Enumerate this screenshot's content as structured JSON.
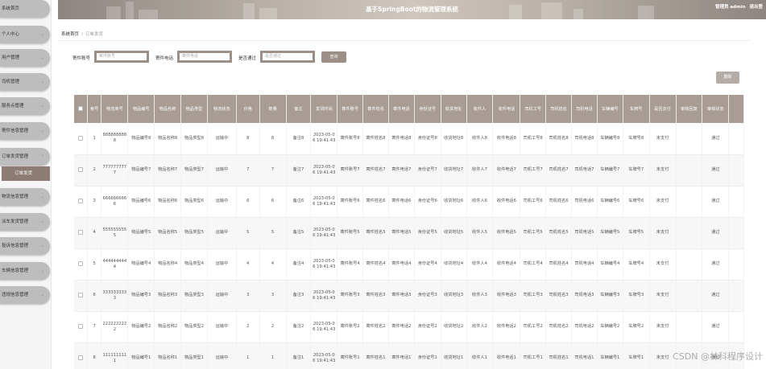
{
  "sidebar": {
    "items": [
      {
        "label": "系统首页",
        "arrow": ""
      },
      {
        "label": "个人中心",
        "arrow": "⌄"
      },
      {
        "label": "用户管理",
        "arrow": "⌄"
      },
      {
        "label": "司机管理",
        "arrow": "⌄"
      },
      {
        "label": "服务点管理",
        "arrow": "⌄"
      },
      {
        "label": "寄件信息管理",
        "arrow": "⌄"
      },
      {
        "label": "订单发货管理",
        "arrow": "⌃"
      },
      {
        "label": "物流信息管理",
        "arrow": "⌄"
      },
      {
        "label": "派车发货管理",
        "arrow": "⌄"
      },
      {
        "label": "投诉信息管理",
        "arrow": "⌄"
      },
      {
        "label": "车辆信息管理",
        "arrow": "⌄"
      },
      {
        "label": "违规信息管理",
        "arrow": "⌄"
      }
    ],
    "submenu": {
      "label": "订单发货"
    }
  },
  "header": {
    "title": "基于SpringBoot的物流管理系统",
    "user_label": "管理员 admin",
    "logout_label": "退出登"
  },
  "breadcrumb": {
    "home": "系统首页",
    "separator": "/",
    "current": "订单发货"
  },
  "search": {
    "fields": [
      {
        "label": "寄件账号",
        "placeholder": "寄件账号"
      },
      {
        "label": "寄件电话",
        "placeholder": "寄件电话"
      },
      {
        "label": "是否通过",
        "placeholder": "是否通过"
      }
    ],
    "button_label": "查询"
  },
  "toolbar": {
    "delete_label": "删除"
  },
  "table": {
    "headers": [
      "索号",
      "物流单号",
      "物品编号",
      "物品名称",
      "物品类型",
      "物流状态",
      "价格",
      "数量",
      "备注",
      "发货时间",
      "寄件账号",
      "寄件姓名",
      "寄件电话",
      "身份证号",
      "收货地址",
      "收件人",
      "收件电话",
      "司机工号",
      "司机姓名",
      "司机电话",
      "车辆编号",
      "车牌号",
      "是否支付",
      "审核回复",
      "审核状态"
    ],
    "rows": [
      [
        "1",
        "8888888888",
        "物品编号8",
        "物品名称8",
        "物品类型8",
        "运输中",
        "8",
        "8",
        "备注8",
        "2023-05-06 19:41:43",
        "寄件账号8",
        "寄件姓名8",
        "寄件电话8",
        "身份证号8",
        "收货地址8",
        "收件人8",
        "收件电话8",
        "司机工号8",
        "司机姓名8",
        "司机电话8",
        "车辆编号8",
        "车牌号8",
        "未支付",
        "",
        "通过"
      ],
      [
        "2",
        "7777777777",
        "物品编号7",
        "物品名称7",
        "物品类型7",
        "运输中",
        "7",
        "7",
        "备注7",
        "2023-05-06 19:41:43",
        "寄件账号7",
        "寄件姓名7",
        "寄件电话7",
        "身份证号7",
        "收货地址7",
        "收件人7",
        "收件电话7",
        "司机工号7",
        "司机姓名7",
        "司机电话7",
        "车辆编号7",
        "车牌号7",
        "未支付",
        "",
        "通过"
      ],
      [
        "3",
        "6666666666",
        "物品编号6",
        "物品名称6",
        "物品类型6",
        "运输中",
        "6",
        "6",
        "备注6",
        "2023-05-06 19:41:43",
        "寄件账号6",
        "寄件姓名6",
        "寄件电话6",
        "身份证号6",
        "收货地址6",
        "收件人6",
        "收件电话6",
        "司机工号6",
        "司机姓名6",
        "司机电话6",
        "车辆编号6",
        "车牌号6",
        "未支付",
        "",
        "通过"
      ],
      [
        "4",
        "5555555555",
        "物品编号5",
        "物品名称5",
        "物品类型5",
        "运输中",
        "5",
        "5",
        "备注5",
        "2023-05-06 19:41:43",
        "寄件账号5",
        "寄件姓名5",
        "寄件电话5",
        "身份证号5",
        "收货地址5",
        "收件人5",
        "收件电话5",
        "司机工号5",
        "司机姓名5",
        "司机电话5",
        "车辆编号5",
        "车牌号5",
        "未支付",
        "",
        "通过"
      ],
      [
        "5",
        "4444444444",
        "物品编号4",
        "物品名称4",
        "物品类型4",
        "运输中",
        "4",
        "4",
        "备注4",
        "2023-05-06 19:41:43",
        "寄件账号4",
        "寄件姓名4",
        "寄件电话4",
        "身份证号4",
        "收货地址4",
        "收件人4",
        "收件电话4",
        "司机工号4",
        "司机姓名4",
        "司机电话4",
        "车辆编号4",
        "车牌号4",
        "未支付",
        "",
        "通过"
      ],
      [
        "6",
        "3333333333",
        "物品编号3",
        "物品名称3",
        "物品类型3",
        "运输中",
        "3",
        "3",
        "备注3",
        "2023-05-06 19:41:43",
        "寄件账号3",
        "寄件姓名3",
        "寄件电话3",
        "身份证号3",
        "收货地址3",
        "收件人3",
        "收件电话3",
        "司机工号3",
        "司机姓名3",
        "司机电话3",
        "车辆编号3",
        "车牌号3",
        "未支付",
        "",
        "通过"
      ],
      [
        "7",
        "2222222222",
        "物品编号2",
        "物品名称2",
        "物品类型2",
        "运输中",
        "2",
        "2",
        "备注2",
        "2023-05-06 19:41:43",
        "寄件账号2",
        "寄件姓名2",
        "寄件电话2",
        "身份证号2",
        "收货地址2",
        "收件人2",
        "收件电话2",
        "司机工号2",
        "司机姓名2",
        "司机电话2",
        "车辆编号2",
        "车牌号2",
        "未支付",
        "",
        "通过"
      ],
      [
        "8",
        "1111111111",
        "物品编号1",
        "物品名称1",
        "物品类型1",
        "运输中",
        "1",
        "1",
        "备注1",
        "2023-05-06 19:41:43",
        "寄件账号1",
        "寄件姓名1",
        "寄件电话1",
        "身份证号1",
        "收货地址1",
        "收件人1",
        "收件电话1",
        "司机工号1",
        "司机姓名1",
        "司机电话1",
        "车辆编号1",
        "车牌号1",
        "未支付",
        "",
        "通过"
      ]
    ]
  },
  "watermark": "CSDN @林科程序设计",
  "colors": {
    "accent": "#9c8f88",
    "header_row": "#a89c95",
    "submenu": "#8c7c74",
    "menu": "#bdbdbd"
  }
}
